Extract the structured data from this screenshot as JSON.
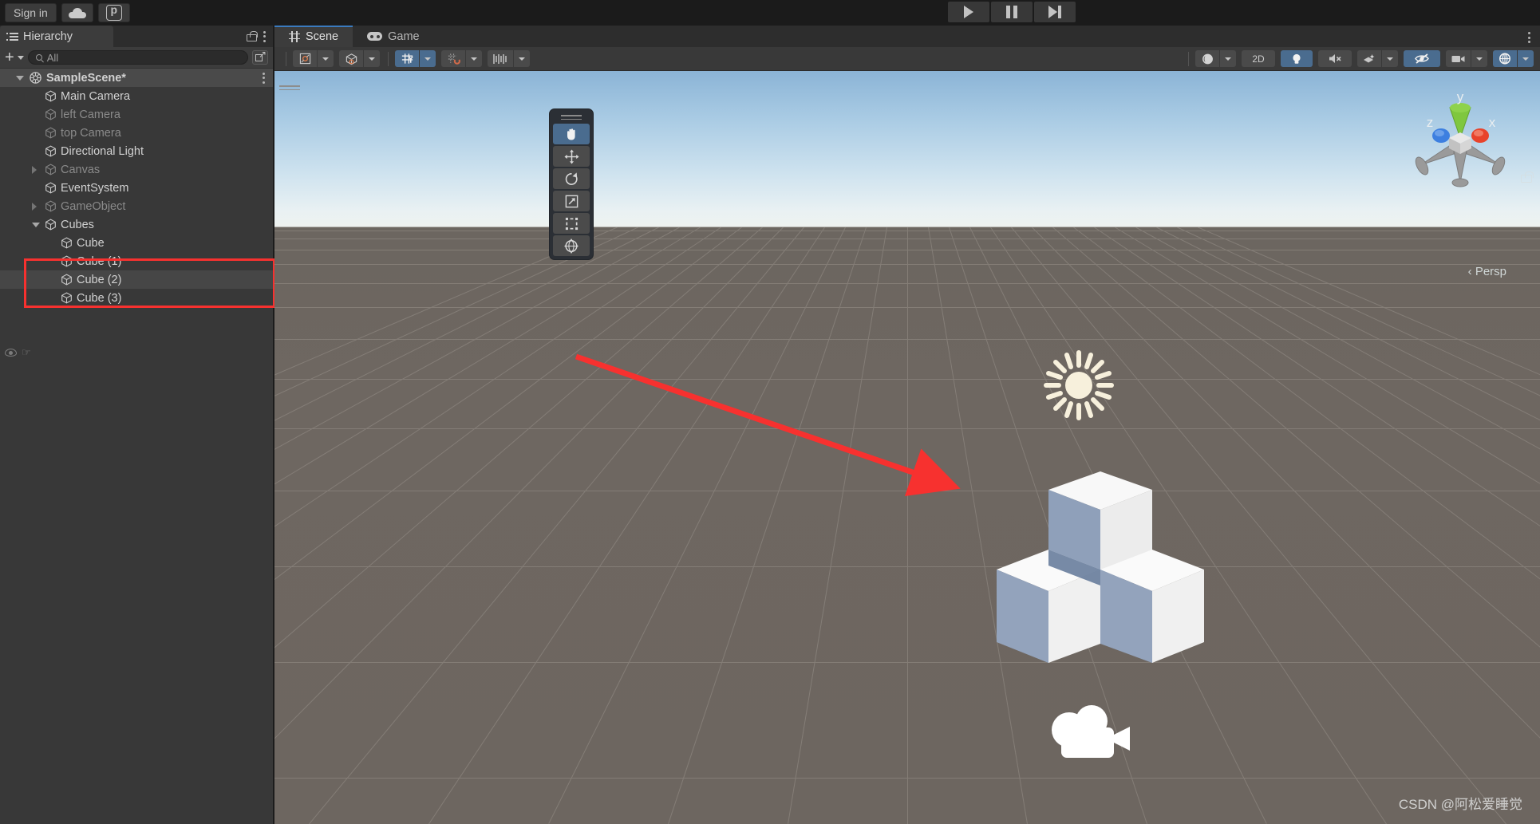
{
  "topbar": {
    "signin_label": "Sign in",
    "cloud_icon": "cloud-icon",
    "unity_icon": "unity-services-icon",
    "play_label": "▶",
    "pause_label": "⏸",
    "step_label": "⏭"
  },
  "hierarchy": {
    "tab_label": "Hierarchy",
    "lock_icon": "lock-icon",
    "menu_icon": "kebab-menu-icon",
    "add_label": "+",
    "search_placeholder": "All",
    "search_value": "All",
    "search_icon": "search-icon",
    "expand_icon": "expand-window-icon",
    "tree": [
      {
        "label": "SampleScene*",
        "indent": 1,
        "icon": "scene-icon",
        "arrow": "open",
        "dim": false,
        "selected": false,
        "kebab": true
      },
      {
        "label": "Main Camera",
        "indent": 2,
        "icon": "gameobject-icon",
        "arrow": "none",
        "dim": false,
        "selected": false,
        "kebab": false
      },
      {
        "label": "left Camera",
        "indent": 2,
        "icon": "gameobject-icon",
        "arrow": "none",
        "dim": true,
        "selected": false,
        "kebab": false
      },
      {
        "label": "top Camera",
        "indent": 2,
        "icon": "gameobject-icon",
        "arrow": "none",
        "dim": true,
        "selected": false,
        "kebab": false
      },
      {
        "label": "Directional Light",
        "indent": 2,
        "icon": "gameobject-icon",
        "arrow": "none",
        "dim": false,
        "selected": false,
        "kebab": false
      },
      {
        "label": "Canvas",
        "indent": 2,
        "icon": "gameobject-icon",
        "arrow": "closed",
        "dim": true,
        "selected": false,
        "kebab": false
      },
      {
        "label": "EventSystem",
        "indent": 2,
        "icon": "gameobject-icon",
        "arrow": "none",
        "dim": false,
        "selected": false,
        "kebab": false
      },
      {
        "label": "GameObject",
        "indent": 2,
        "icon": "gameobject-icon",
        "arrow": "closed",
        "dim": true,
        "selected": false,
        "kebab": false
      },
      {
        "label": "Cubes",
        "indent": 2,
        "icon": "gameobject-icon",
        "arrow": "open",
        "dim": false,
        "selected": false,
        "kebab": false
      },
      {
        "label": "Cube",
        "indent": 3,
        "icon": "gameobject-icon",
        "arrow": "none",
        "dim": false,
        "selected": false,
        "kebab": false
      },
      {
        "label": "Cube (1)",
        "indent": 3,
        "icon": "gameobject-icon",
        "arrow": "none",
        "dim": false,
        "selected": false,
        "kebab": false
      },
      {
        "label": "Cube (2)",
        "indent": 3,
        "icon": "gameobject-icon",
        "arrow": "none",
        "dim": false,
        "selected": true,
        "kebab": false
      },
      {
        "label": "Cube (3)",
        "indent": 3,
        "icon": "gameobject-icon",
        "arrow": "none",
        "dim": false,
        "selected": false,
        "kebab": false
      }
    ],
    "gutter": {
      "visibility_icon": "eye-icon",
      "pick_icon": "hand-pointer-icon"
    },
    "highlight_color": "#f7312f"
  },
  "scene_panel": {
    "tabs": [
      {
        "label": "Scene",
        "icon": "scene-grid-icon",
        "active": true
      },
      {
        "label": "Game",
        "icon": "gamepad-icon",
        "active": false
      }
    ],
    "menu_icon": "kebab-menu-icon",
    "toolbar_left": [
      {
        "name": "pivot-mode-button",
        "icon": "pivot-center-icon",
        "active": false,
        "dropdown": true
      },
      {
        "name": "handle-orientation-button",
        "icon": "global-local-icon",
        "active": false,
        "dropdown": true
      },
      {
        "name": "grid-visibility-button",
        "icon": "grid-axis-y-icon",
        "active": true,
        "dropdown": true
      },
      {
        "name": "grid-snapping-button",
        "icon": "grid-magnet-icon",
        "active": false,
        "dropdown": true
      },
      {
        "name": "snap-increment-button",
        "icon": "snap-ruler-icon",
        "active": false,
        "dropdown": true
      }
    ],
    "toolbar_right": [
      {
        "name": "shading-mode-button",
        "label": "",
        "icon": "shaded-sphere-icon",
        "active": false,
        "dropdown": true
      },
      {
        "name": "toggle-2d-button",
        "label": "2D",
        "icon": "",
        "active": false,
        "dropdown": false
      },
      {
        "name": "scene-lighting-button",
        "label": "",
        "icon": "lightbulb-icon",
        "active": true,
        "dropdown": false
      },
      {
        "name": "scene-audio-button",
        "label": "",
        "icon": "audio-mute-icon",
        "active": false,
        "dropdown": false
      },
      {
        "name": "scene-fx-button",
        "label": "",
        "icon": "effects-icon",
        "active": false,
        "dropdown": true
      },
      {
        "name": "scene-visibility-button",
        "label": "",
        "icon": "eye-slash-icon",
        "active": true,
        "dropdown": false
      },
      {
        "name": "camera-settings-button",
        "label": "",
        "icon": "camera-icon",
        "active": false,
        "dropdown": true
      },
      {
        "name": "gizmos-button",
        "label": "",
        "icon": "gizmos-globe-icon",
        "active": true,
        "dropdown": true
      }
    ],
    "tools": [
      {
        "name": "hand-tool",
        "icon": "hand-icon",
        "active": true
      },
      {
        "name": "move-tool",
        "icon": "move-arrows-icon",
        "active": false
      },
      {
        "name": "rotate-tool",
        "icon": "rotate-icon",
        "active": false
      },
      {
        "name": "scale-tool",
        "icon": "scale-icon",
        "active": false
      },
      {
        "name": "rect-transform-tool",
        "icon": "rect-transform-icon",
        "active": false
      },
      {
        "name": "transform-tool",
        "icon": "transform-globe-icon",
        "active": false
      }
    ],
    "viewgizmo": {
      "x_label": "x",
      "y_label": "y",
      "z_label": "z",
      "projection_label": "Persp",
      "projection_prefix": "‹",
      "lock_icon": "lock-icon",
      "x_color": "#e8432b",
      "y_color": "#7fc73f",
      "z_color": "#3d7fe0"
    },
    "gizmos": {
      "light_icon": "directional-light-sun-gizmo",
      "camera_icon": "camera-gizmo"
    },
    "annotation": {
      "arrow_color": "#f7312f",
      "arrow_icon": "red-pointer-arrow"
    }
  },
  "watermark": {
    "text": "CSDN @阿松爱睡觉"
  }
}
